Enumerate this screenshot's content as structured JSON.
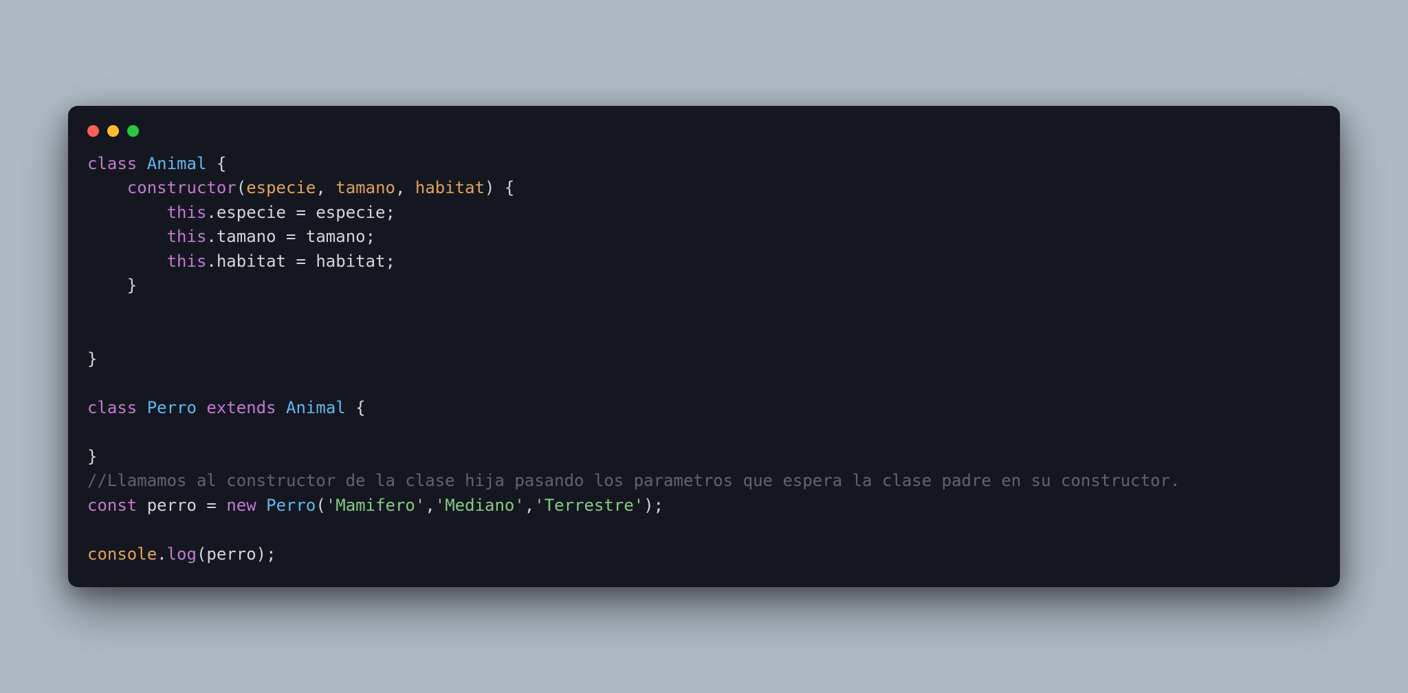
{
  "colors": {
    "background": "#aeb9c4",
    "window_bg": "#151720",
    "dot_red": "#ff5f57",
    "dot_yellow": "#febc2e",
    "dot_green": "#28c840",
    "keyword": "#c07bd0",
    "classname": "#63b6ec",
    "param": "#dfa35a",
    "string": "#89c987",
    "comment": "#5d6470",
    "text": "#d4d5d9"
  },
  "code": {
    "kw_class1": "class",
    "cls_animal": "Animal",
    "brace_open1": " {",
    "indent1": "    ",
    "fn_constructor": "constructor",
    "paren_open1": "(",
    "param_especie": "especie",
    "comma1": ", ",
    "param_tamano": "tamano",
    "comma2": ", ",
    "param_habitat": "habitat",
    "paren_close_brace1": ") {",
    "indent2": "        ",
    "kw_this1": "this",
    "dot1": ".",
    "prop_especie": "especie",
    "eq1": " = ",
    "rhs_especie": "especie",
    "semi1": ";",
    "kw_this2": "this",
    "dot2": ".",
    "prop_tamano": "tamano",
    "eq2": " = ",
    "rhs_tamano": "tamano",
    "semi2": ";",
    "kw_this3": "this",
    "dot3": ".",
    "prop_habitat": "habitat",
    "eq3": " = ",
    "rhs_habitat": "habitat",
    "semi3": ";",
    "brace_close_inner": "    }",
    "brace_close1": "}",
    "kw_class2": "class",
    "cls_perro": "Perro",
    "kw_extends": "extends",
    "cls_animal2": "Animal",
    "brace_open2": " {",
    "brace_close2": "}",
    "comment": "//Llamamos al constructor de la clase hija pasando los parametros que espera la clase padre en su constructor.",
    "kw_const": "const",
    "var_perro": "perro",
    "eq4": " = ",
    "kw_new": "new",
    "cls_perro2": "Perro",
    "paren_open2": "(",
    "str_mamifero": "'Mamifero'",
    "comma3": ",",
    "str_mediano": "'Mediano'",
    "comma4": ",",
    "str_terrestre": "'Terrestre'",
    "paren_close_semi": ");",
    "obj_console": "console",
    "dot4": ".",
    "fn_log": "log",
    "paren_open3": "(",
    "arg_perro": "perro",
    "paren_close_semi2": ");"
  }
}
